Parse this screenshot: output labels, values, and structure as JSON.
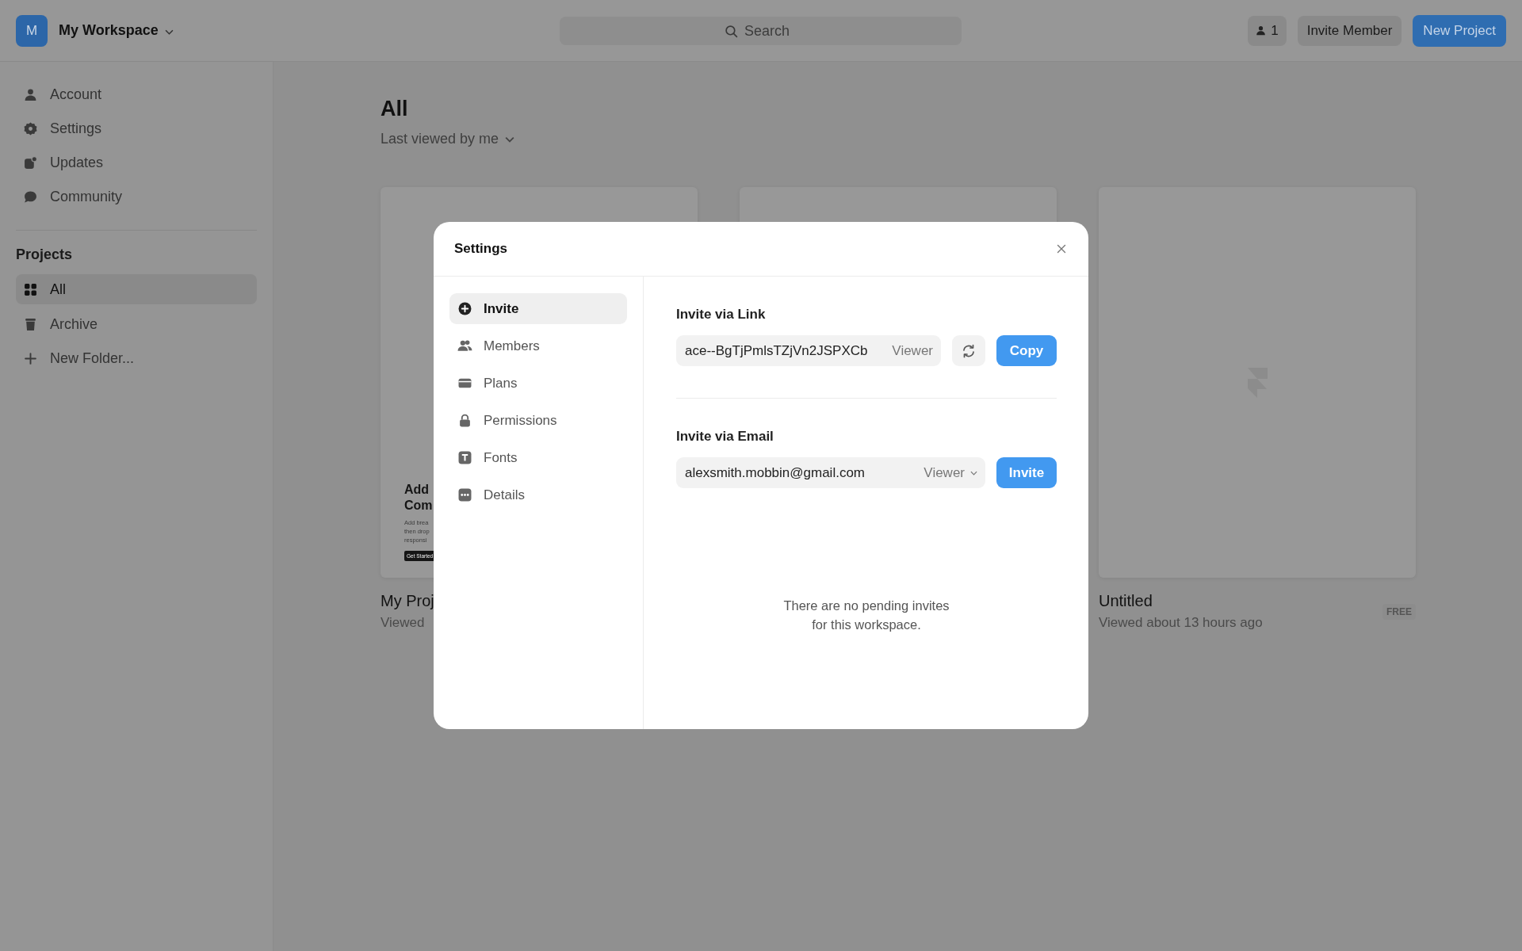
{
  "topbar": {
    "workspace": {
      "avatar": "M",
      "name": "My Workspace"
    },
    "search": {
      "placeholder": "Search"
    },
    "member_count": "1",
    "buttons": [
      {
        "label": "Invite Member",
        "kind": "secondary"
      },
      {
        "label": "New Project",
        "kind": "primary"
      }
    ]
  },
  "sidebar": {
    "items": [
      {
        "label": "Account"
      },
      {
        "label": "Settings"
      },
      {
        "label": "Updates"
      },
      {
        "label": "Community"
      }
    ],
    "projects_heading": "Projects",
    "projects": [
      {
        "label": "All",
        "selected": true
      },
      {
        "label": "Archive",
        "selected": false
      }
    ],
    "new_folder": "New Folder..."
  },
  "main": {
    "title": "All",
    "sort": "Last viewed by me",
    "cards": [
      {
        "thumbnail": {
          "kind": "page",
          "heading": [
            "Add",
            "Com"
          ],
          "body": [
            "Add brea",
            "then drop",
            "responsi"
          ],
          "button": "Get Started"
        },
        "title": "My Proj",
        "subtitle": "Viewed"
      },
      {
        "thumbnail": {
          "kind": "blank"
        }
      },
      {
        "thumbnail": {
          "kind": "placeholder"
        },
        "title": "Untitled",
        "subtitle": "Viewed about 13 hours ago",
        "badge": "FREE"
      }
    ]
  },
  "modal": {
    "title": "Settings",
    "nav": [
      {
        "label": "Invite",
        "selected": true
      },
      {
        "label": "Members",
        "selected": false
      },
      {
        "label": "Plans",
        "selected": false
      },
      {
        "label": "Permissions",
        "selected": false
      },
      {
        "label": "Fonts",
        "selected": false
      },
      {
        "label": "Details",
        "selected": false
      }
    ],
    "link": {
      "label": "Invite via Link",
      "value": "ace--BgTjPmlsTZjVn2JSPXCb",
      "role": "Viewer",
      "button": "Copy"
    },
    "email": {
      "label": "Invite via Email",
      "value": "alexsmith.mobbin@gmail.com",
      "role": "Viewer",
      "button": "Invite"
    },
    "empty_text": "There are no pending invites for this workspace."
  }
}
